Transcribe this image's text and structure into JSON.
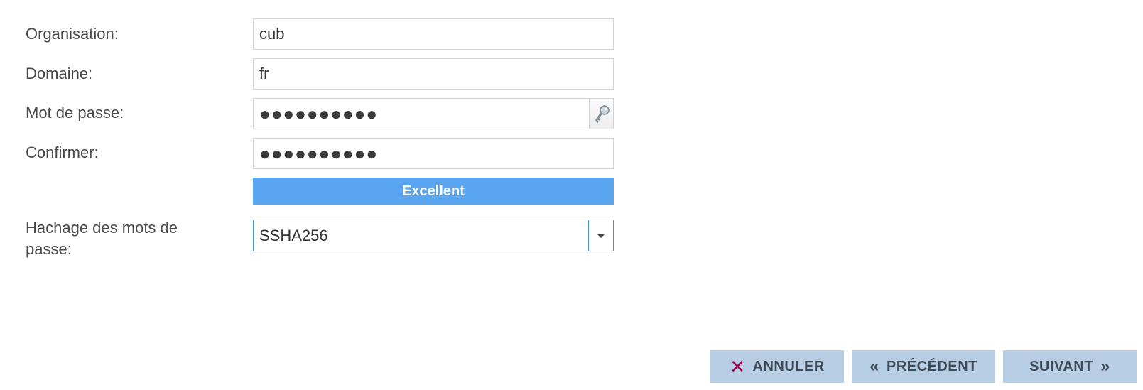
{
  "form": {
    "organisation": {
      "label": "Organisation:",
      "value": "cub"
    },
    "domaine": {
      "label": "Domaine:",
      "value": "fr"
    },
    "mot_de_passe": {
      "label": "Mot de passe:",
      "value": "●●●●●●●●●●"
    },
    "confirmer": {
      "label": "Confirmer:",
      "value": "●●●●●●●●●●"
    },
    "strength": {
      "text": "Excellent",
      "color": "#5aa5f0"
    },
    "hachage": {
      "label": "Hachage des mots de passe:",
      "value": "SSHA256"
    }
  },
  "buttons": {
    "annuler": {
      "label": "ANNULER",
      "icon": "close-icon",
      "icon_glyph": "✕"
    },
    "precedent": {
      "label": "PRÉCÉDENT",
      "icon": "double-chevron-left-icon",
      "icon_glyph": "«"
    },
    "suivant": {
      "label": "SUIVANT",
      "icon": "double-chevron-right-icon",
      "icon_glyph": "»"
    }
  },
  "colors": {
    "button_bg": "#b6cde3",
    "select_border": "#3a9ad9",
    "cancel_icon": "#a0004a"
  }
}
